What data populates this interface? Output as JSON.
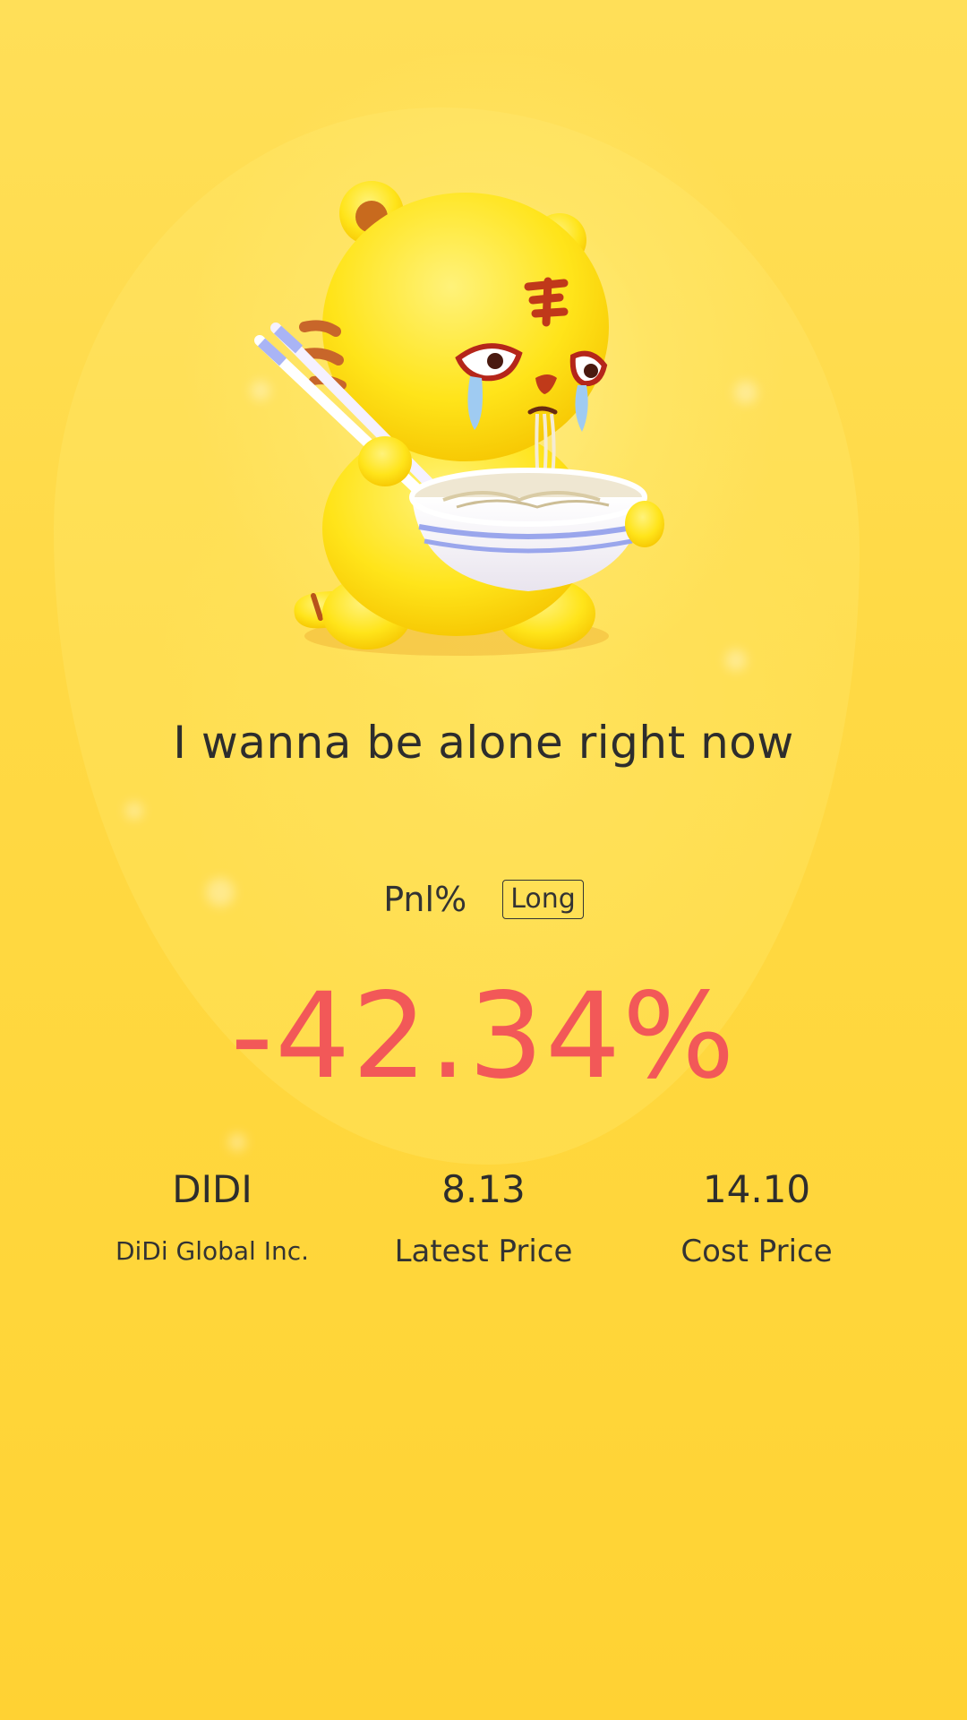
{
  "headline": "I wanna be alone right now",
  "pnl": {
    "label": "Pnl%",
    "position_badge": "Long",
    "value": "-42.34%",
    "value_color": "#F25858"
  },
  "stock": {
    "symbol": "DIDI",
    "name": "DiDi Global Inc."
  },
  "prices": {
    "latest_value": "8.13",
    "latest_label": "Latest Price",
    "cost_value": "14.10",
    "cost_label": "Cost Price"
  },
  "colors": {
    "background": "#FFD83B",
    "text": "#2d2d2d",
    "loss": "#F25858"
  },
  "illustration": "crying-tiger-eating-noodles-icon"
}
